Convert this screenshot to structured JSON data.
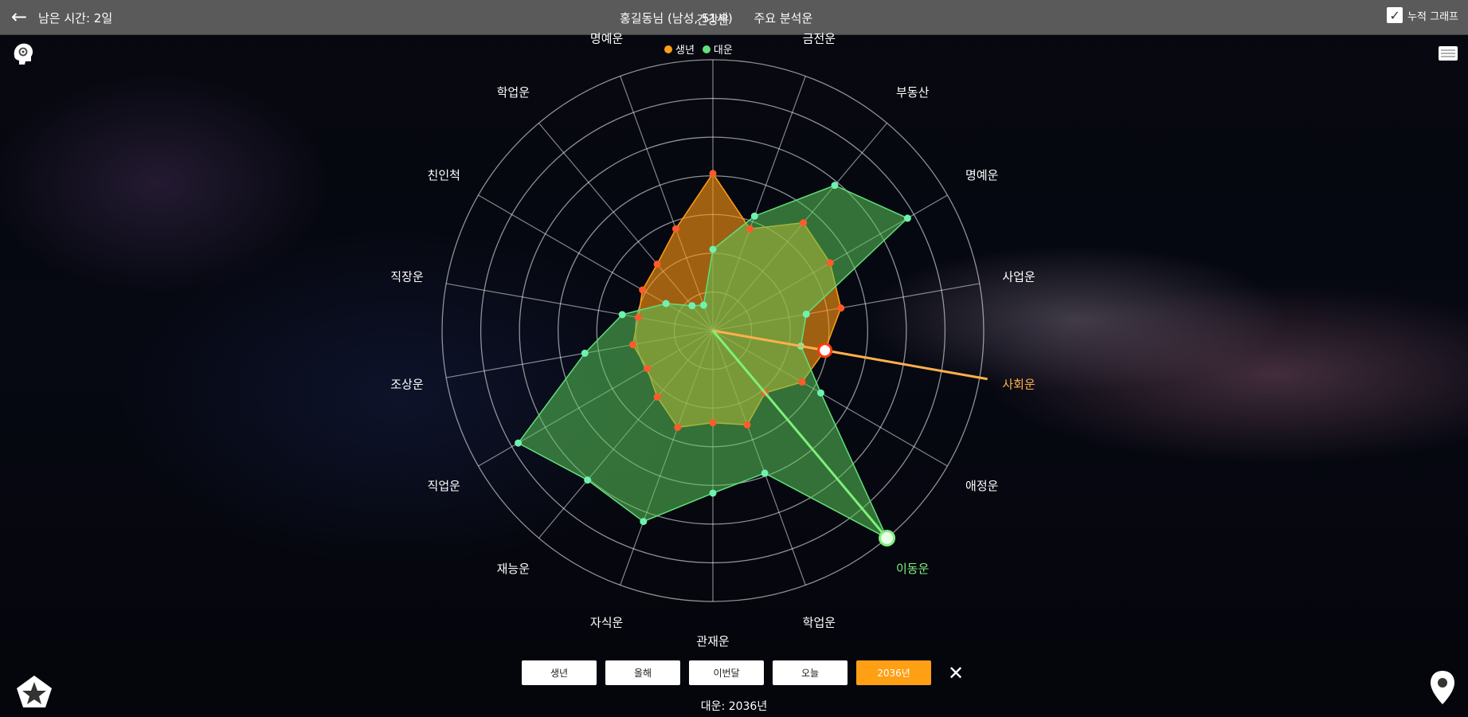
{
  "topbar": {
    "remaining_time": "남은 시간: 2일",
    "profile": "홍길동님 (남성, 51세)",
    "analysis": "주요 분석운",
    "accumulate_label": "누적 그래프",
    "accumulate_checked": true
  },
  "icons": {
    "back": "back-arrow-icon",
    "top_left": "head-icon",
    "top_right": "menu-icon",
    "bottom_left": "star-badge-icon",
    "bottom_right": "location-pin-icon"
  },
  "colors": {
    "birth": "#ff9f14",
    "luck": "#5fe07a",
    "birth_point": "#ff5a2a",
    "luck_point": "#6ef2b0",
    "axis_highlight_birth": "#ffb04a",
    "axis_highlight_luck": "#7ef07a"
  },
  "legend": [
    {
      "label": "생년",
      "color": "#ff9f14"
    },
    {
      "label": "대운",
      "color": "#5fe07a"
    }
  ],
  "chart_data": {
    "type": "radar",
    "axes": [
      "건강운",
      "금전운",
      "부동산",
      "명예운",
      "사업운",
      "사회운",
      "애정운",
      "이동운",
      "학업운",
      "관재운",
      "자식운",
      "재능운",
      "직업운",
      "조상운",
      "직장운",
      "친인척",
      "학업운",
      "명예운"
    ],
    "rmax": 100,
    "grid_rings": 7,
    "series": [
      {
        "name": "생년",
        "values": [
          58,
          40,
          52,
          50,
          48,
          42,
          38,
          30,
          37,
          34,
          38,
          32,
          28,
          30,
          28,
          30,
          32,
          40
        ]
      },
      {
        "name": "대운",
        "values": [
          30,
          45,
          70,
          83,
          35,
          33,
          46,
          100,
          56,
          60,
          75,
          72,
          83,
          48,
          34,
          20,
          12,
          10
        ]
      }
    ],
    "highlight": {
      "birth_axis": "사회운",
      "luck_axis": "이동운"
    }
  },
  "buttons": [
    "생년",
    "올해",
    "이번달",
    "오늘",
    "2036년"
  ],
  "active_button": 4,
  "close_label": "✕",
  "footer": "대운: 2036년"
}
